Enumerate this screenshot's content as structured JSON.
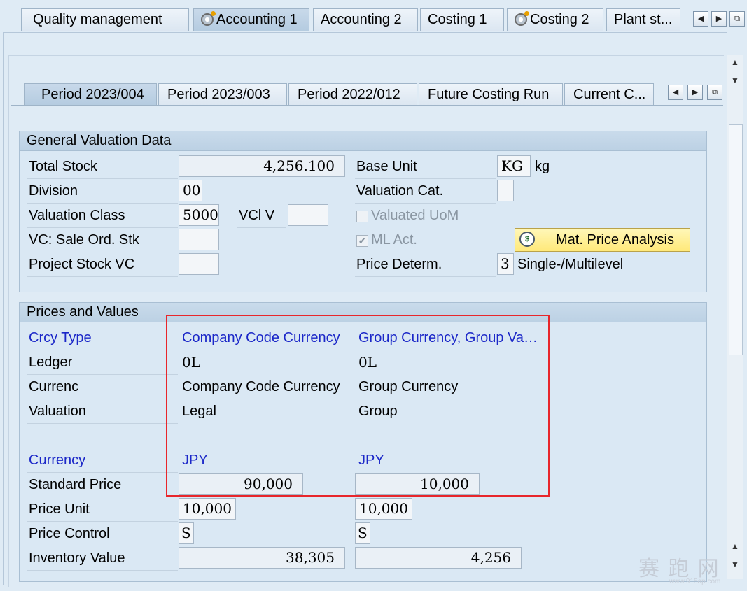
{
  "top_tabs": [
    "Quality management",
    "Accounting 1",
    "Accounting 2",
    "Costing 1",
    "Costing 2",
    "Plant st..."
  ],
  "sub_tabs": [
    "Period 2023/004",
    "Period 2023/003",
    "Period 2022/012",
    "Future Costing Run",
    "Current C..."
  ],
  "general": {
    "title": "General Valuation Data",
    "total_stock_label": "Total Stock",
    "total_stock_value": "4,256.100",
    "base_unit_label": "Base Unit",
    "base_unit_value": "KG",
    "base_unit_text": "kg",
    "division_label": "Division",
    "division_value": "00",
    "valuation_cat_label": "Valuation Cat.",
    "valuation_cat_value": "",
    "valuation_class_label": "Valuation Class",
    "valuation_class_value": "5000",
    "vcl_v_label": "VCl V",
    "vcl_v_value": "",
    "valuated_uom_label": "Valuated UoM",
    "vc_sale_label": "VC: Sale Ord. Stk",
    "vc_sale_value": "",
    "ml_act_label": "ML Act.",
    "mat_price_button": "Mat. Price Analysis",
    "project_stock_label": "Project Stock VC",
    "project_stock_value": "",
    "price_determ_label": "Price Determ.",
    "price_determ_value": "3",
    "price_determ_text": "Single-/Multilevel"
  },
  "prices": {
    "title": "Prices and Values",
    "crcy_type_label": "Crcy Type",
    "ledger_label": "Ledger",
    "currenc_label": "Currenc",
    "valuation_label": "Valuation",
    "currency_label": "Currency",
    "standard_price_label": "Standard Price",
    "price_unit_label": "Price Unit",
    "price_control_label": "Price Control",
    "inventory_value_label": "Inventory Value",
    "col1": {
      "crcy_type": "Company Code Currency",
      "ledger": "0L",
      "currenc": "Company Code Currency",
      "valuation": "Legal",
      "currency": "JPY",
      "standard_price": "90,000",
      "price_unit": "10,000",
      "price_control": "S",
      "inventory_value": "38,305"
    },
    "col2": {
      "crcy_type": "Group Currency, Group Va…",
      "ledger": "0L",
      "currenc": "Group Currency",
      "valuation": "Group",
      "currency": "JPY",
      "standard_price": "10,000",
      "price_unit": "10,000",
      "price_control": "S",
      "inventory_value": "4,256"
    }
  },
  "watermark": {
    "text": "赛 跑 网",
    "sub": "www.915ap.com"
  },
  "colors": {
    "highlight_border": "#e8262b",
    "label_blue": "#1b27c8",
    "button_yellow": "#ffe97a"
  }
}
